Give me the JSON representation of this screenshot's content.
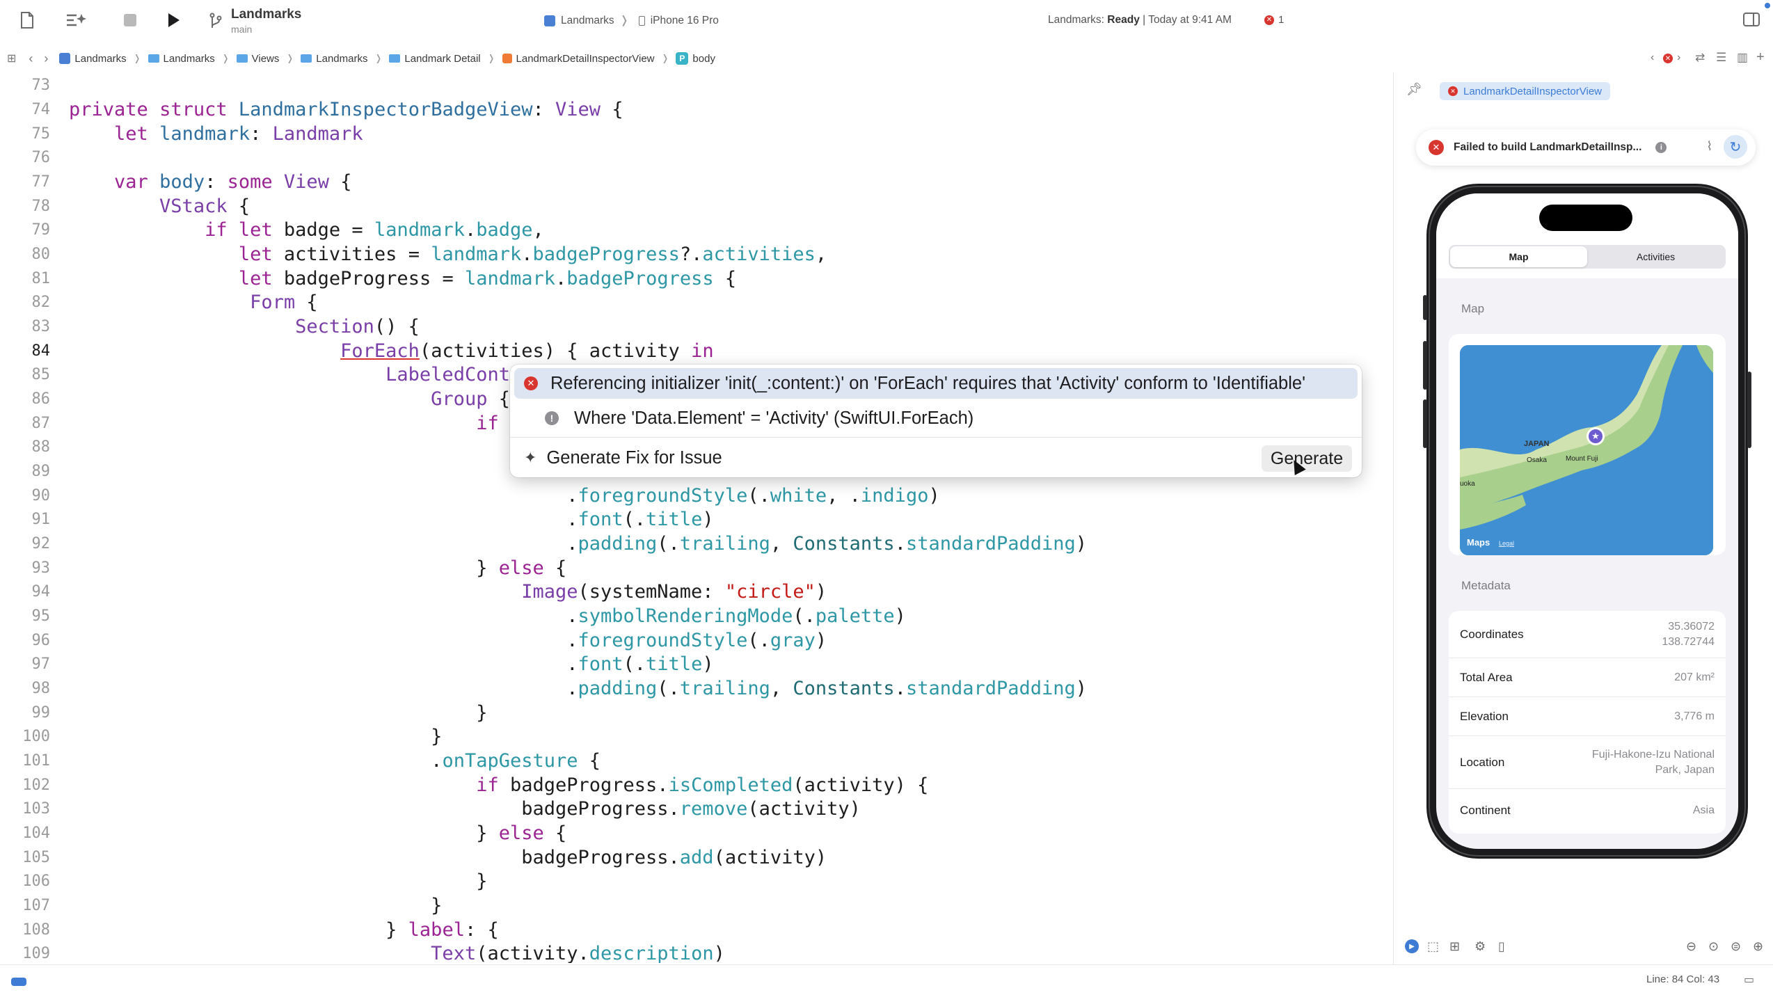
{
  "toolbar": {
    "scheme_name": "Landmarks",
    "scheme_branch": "main",
    "run_target": "Landmarks",
    "run_device": "iPhone 16 Pro",
    "status_app": "Landmarks:",
    "status_state": "Ready",
    "status_time": "| Today at 9:41 AM",
    "error_count": "1"
  },
  "jumpbar": {
    "crumbs": [
      "Landmarks",
      "Landmarks",
      "Views",
      "Landmarks",
      "Landmark Detail",
      "LandmarkDetailInspectorView",
      "body"
    ]
  },
  "editor": {
    "current_line": "84",
    "line_numbers": [
      "73",
      "74",
      "75",
      "76",
      "77",
      "78",
      "79",
      "80",
      "81",
      "82",
      "83",
      "84",
      "85",
      "86",
      "87",
      "88",
      "89",
      "90",
      "91",
      "92",
      "93",
      "94",
      "95",
      "96",
      "97",
      "98",
      "99",
      "100",
      "101",
      "102",
      "103",
      "104",
      "105",
      "106",
      "107",
      "108",
      "109"
    ]
  },
  "issue": {
    "error": "Referencing initializer 'init(_:content:)' on 'ForEach' requires that 'Activity' conform to 'Identifiable'",
    "note": "Where 'Data.Element' = 'Activity' (SwiftUI.ForEach)",
    "generate_fix": "Generate Fix for Issue",
    "generate_button": "Generate"
  },
  "canvas": {
    "view_chip": "LandmarkDetailInspectorView",
    "fail_message": "Failed to build LandmarkDetailInsp...",
    "tabs": [
      {
        "label": "Map",
        "active": true
      },
      {
        "label": "Activities",
        "active": false
      }
    ],
    "map_header": "Map",
    "map_labels": {
      "country": "JAPAN",
      "city1": "Osaka",
      "city2": "Mount Fuji",
      "city3": "uoka",
      "brand": "Maps",
      "legal": "Legal"
    },
    "metadata_header": "Metadata",
    "metadata": [
      {
        "label": "Coordinates",
        "value": "35.36072\n138.72744"
      },
      {
        "label": "Total Area",
        "value": "207 km²"
      },
      {
        "label": "Elevation",
        "value": "3,776 m"
      },
      {
        "label": "Location",
        "value": "Fuji-Hakone-Izu National\nPark, Japan"
      },
      {
        "label": "Continent",
        "value": "Asia"
      }
    ]
  },
  "statusbar": {
    "position": "Line: 84  Col: 43"
  },
  "colors": {
    "keyword": "#9b2393",
    "type": "#2f6f9f",
    "property": "#2e97a5",
    "string": "#c41a16",
    "accent": "#3d7bd5",
    "error": "#d9352f"
  }
}
